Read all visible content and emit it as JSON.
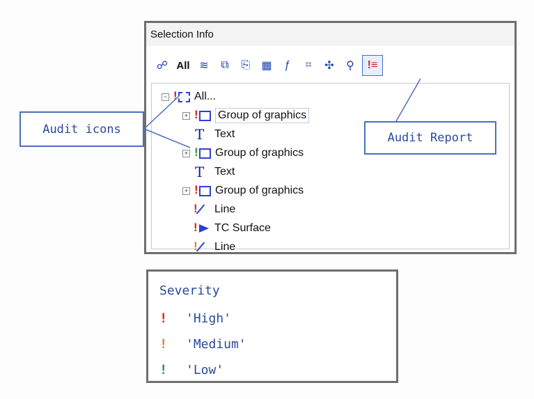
{
  "panel": {
    "title": "Selection Info",
    "toolbar": [
      {
        "icon": "selection-props-icon",
        "glyph": "☍"
      },
      {
        "icon": "all-label",
        "glyph": "All"
      },
      {
        "icon": "filter-icon",
        "glyph": "≋"
      },
      {
        "icon": "layers-icon",
        "glyph": "⧉"
      },
      {
        "icon": "copy-icon",
        "glyph": "⎘"
      },
      {
        "icon": "table-icon",
        "glyph": "▦"
      },
      {
        "icon": "function-icon",
        "glyph": "ƒ"
      },
      {
        "icon": "grid-icon",
        "glyph": "⌗"
      },
      {
        "icon": "tools-icon",
        "glyph": "✣"
      },
      {
        "icon": "search-icon",
        "glyph": "⚲"
      },
      {
        "icon": "audit-report-icon",
        "glyph": "!≡"
      }
    ]
  },
  "tree": [
    {
      "label": "All...",
      "severity": "high",
      "kind": "root"
    },
    {
      "label": "Group of graphics",
      "severity": "high",
      "kind": "group"
    },
    {
      "label": "Text",
      "severity": "none",
      "kind": "text"
    },
    {
      "label": "Group of graphics",
      "severity": "low",
      "kind": "group"
    },
    {
      "label": "Text",
      "severity": "none",
      "kind": "text"
    },
    {
      "label": "Group of graphics",
      "severity": "high",
      "kind": "group"
    },
    {
      "label": "Line",
      "severity": "high",
      "kind": "line"
    },
    {
      "label": "TC Surface",
      "severity": "high",
      "kind": "surface"
    },
    {
      "label": "Line",
      "severity": "medium",
      "kind": "line"
    }
  ],
  "callouts": {
    "audit_icons": "Audit icons",
    "audit_report": "Audit Report"
  },
  "legend": {
    "title": "Severity",
    "items": [
      {
        "label": "'High'",
        "level": "high"
      },
      {
        "label": "'Medium'",
        "level": "medium"
      },
      {
        "label": "'Low'",
        "level": "low"
      }
    ]
  },
  "colors": {
    "high": "#e02020",
    "medium": "#d08a2a",
    "low": "#2a9a3a",
    "callout_text": "#2a4a9c"
  }
}
